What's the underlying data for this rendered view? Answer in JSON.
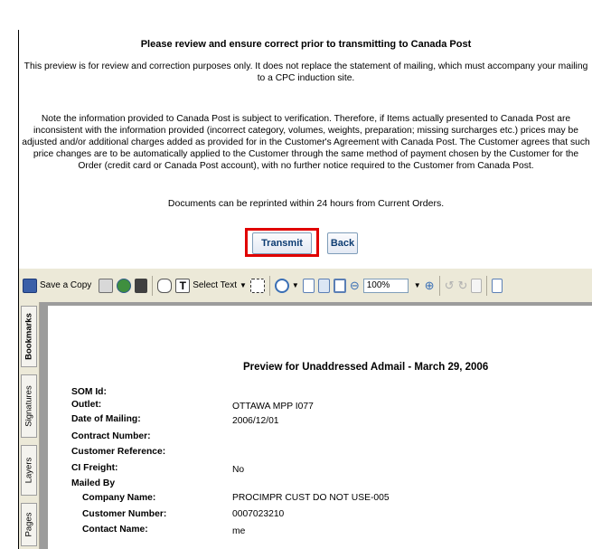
{
  "review": {
    "heading": "Please review and ensure correct prior to transmitting to Canada Post",
    "preview_note": "This preview is for review and correction purposes only. It does not replace the statement of mailing, which must accompany your mailing to a CPC induction site.",
    "verification_note": "Note the information provided to Canada Post is subject to verification. Therefore, if Items actually presented to Canada Post are inconsistent with the information provided (incorrect category, volumes, weights, preparation; missing surcharges etc.) prices may be adjusted and/or additional charges added as provided for in the Customer's Agreement with Canada Post. The Customer agrees that such price changes are to be automatically applied to the Customer through the same method of payment chosen by the Customer for the Order (credit card or Canada Post account), with no further notice required to the Customer from Canada Post.",
    "reprint_note": "Documents can be reprinted within 24 hours from Current Orders.",
    "transmit_label": "Transmit",
    "back_label": "Back"
  },
  "toolbar": {
    "save_copy_label": "Save a Copy",
    "select_text_label": "Select Text",
    "zoom_value": "100%",
    "icons": [
      "save-icon",
      "print-icon",
      "email-icon",
      "search-icon",
      "hand-icon",
      "select-text-icon",
      "snapshot-icon",
      "zoom-in-icon",
      "single-page-icon",
      "continuous-icon",
      "fit-page-icon",
      "zoom-out-icon",
      "zoom-plus-icon",
      "rotate-ccw-icon",
      "rotate-cw-icon",
      "document-icon",
      "export-icon"
    ]
  },
  "sidebar": {
    "tabs": [
      "Bookmarks",
      "Signatures",
      "Layers",
      "Pages"
    ]
  },
  "document": {
    "title": "Preview for Unaddressed Admail  -  March 29, 2006",
    "fields": [
      {
        "label": "SOM Id:",
        "value": ""
      },
      {
        "label": "Outlet:",
        "value": "OTTAWA MPP I077"
      },
      {
        "label": "Date of Mailing:",
        "value": "2006/12/01"
      },
      {
        "label": "Contract Number:",
        "value": ""
      },
      {
        "label": "Customer Reference:",
        "value": ""
      },
      {
        "label": "CI Freight:",
        "value": "No"
      },
      {
        "label": "Mailed By",
        "value": ""
      },
      {
        "label": "Company Name:",
        "value": "PROCIMPR CUST DO NOT USE-005"
      },
      {
        "label": "Customer Number:",
        "value": "0007023210"
      },
      {
        "label": "Contact Name:",
        "value": "me"
      }
    ]
  }
}
